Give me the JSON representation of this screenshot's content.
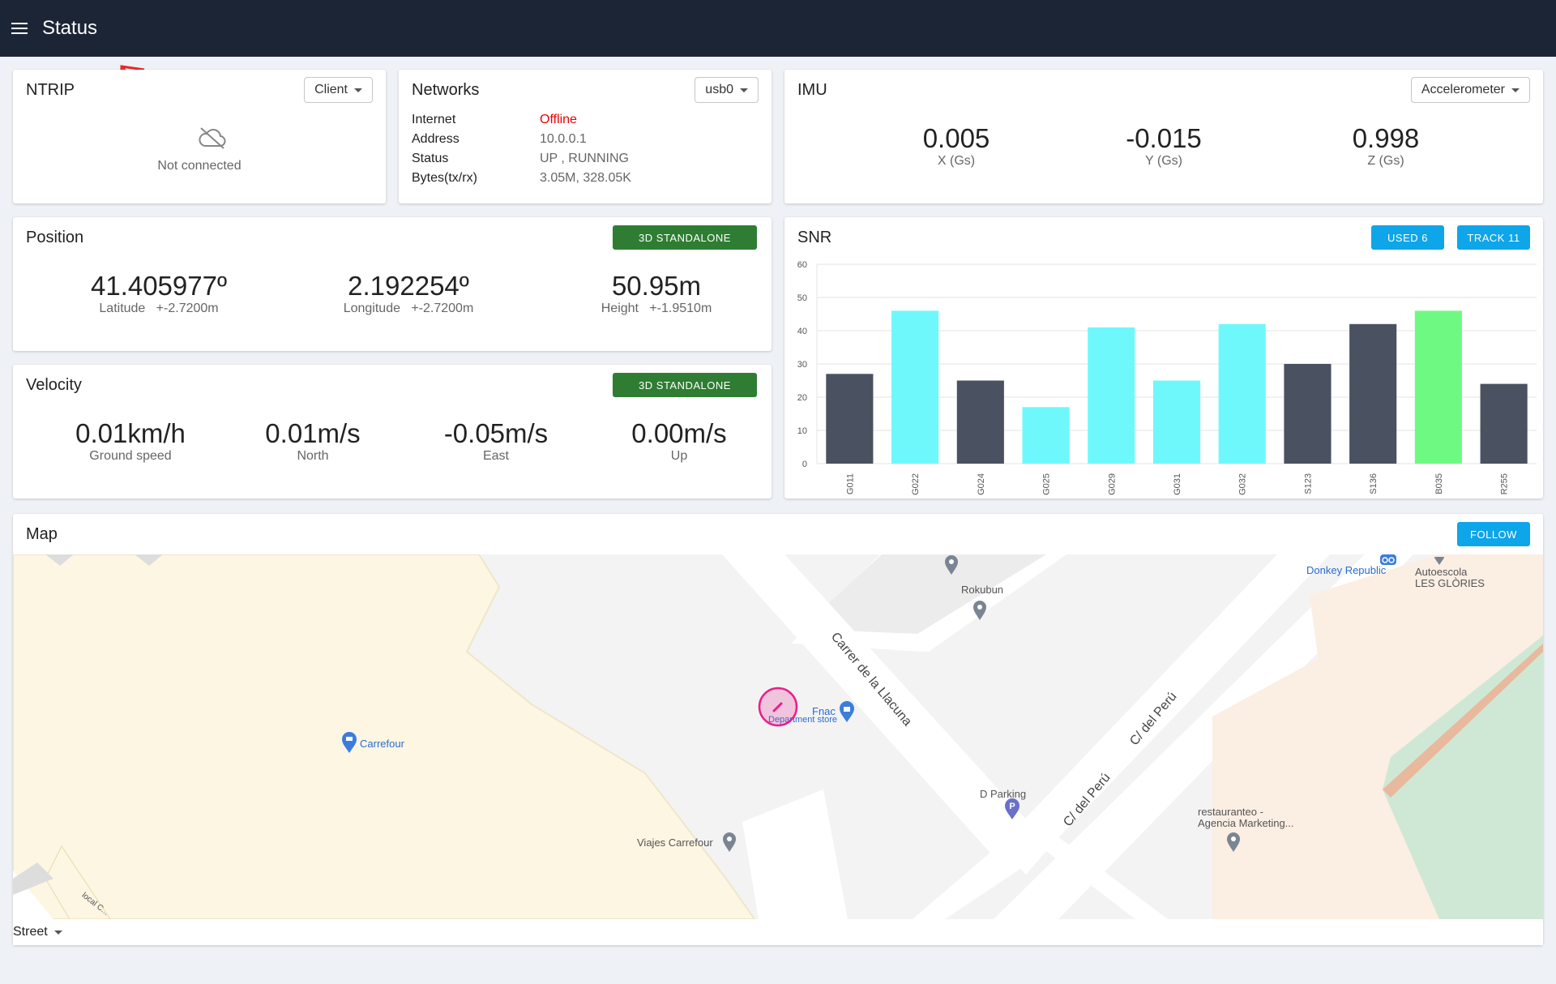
{
  "header": {
    "title": "Status",
    "menu_icon": "menu-icon"
  },
  "ntrip": {
    "title": "NTRIP",
    "mode": "Client",
    "status_icon": "cloud-off-icon",
    "status": "Not connected"
  },
  "networks": {
    "title": "Networks",
    "interface": "usb0",
    "rows": [
      {
        "key": "Internet",
        "value": "Offline"
      },
      {
        "key": "Address",
        "value": "10.0.0.1"
      },
      {
        "key": "Status",
        "value": "UP , RUNNING"
      },
      {
        "key": "Bytes(tx/rx)",
        "value": "3.05M, 328.05K"
      }
    ]
  },
  "imu": {
    "title": "IMU",
    "sensor": "Accelerometer",
    "x": {
      "value": "0.005",
      "label": "X (Gs)"
    },
    "y": {
      "value": "-0.015",
      "label": "Y (Gs)"
    },
    "z": {
      "value": "0.998",
      "label": "Z (Gs)"
    }
  },
  "position": {
    "title": "Position",
    "fix": "3D STANDALONE",
    "latitude": {
      "value": "41.405977º",
      "label": "Latitude",
      "accuracy": "+-2.7200m"
    },
    "longitude": {
      "value": "2.192254º",
      "label": "Longitude",
      "accuracy": "+-2.7200m"
    },
    "height": {
      "value": "50.95m",
      "label": "Height",
      "accuracy": "+-1.9510m"
    }
  },
  "velocity": {
    "title": "Velocity",
    "fix": "3D STANDALONE",
    "ground": {
      "value": "0.01km/h",
      "label": "Ground speed"
    },
    "north": {
      "value": "0.01m/s",
      "label": "North"
    },
    "east": {
      "value": "-0.05m/s",
      "label": "East"
    },
    "up": {
      "value": "0.00m/s",
      "label": "Up"
    }
  },
  "snr": {
    "title": "SNR",
    "used_label": "USED 6",
    "track_label": "TRACK 11"
  },
  "chart_data": {
    "type": "bar",
    "title": "SNR",
    "categories": [
      "G011",
      "G022",
      "G024",
      "G025",
      "G029",
      "G031",
      "G032",
      "S123",
      "S136",
      "B035",
      "R255"
    ],
    "values": [
      27,
      46,
      25,
      17,
      41,
      25,
      42,
      30,
      42,
      46,
      24
    ],
    "colors": [
      "#4a5160",
      "#6ff8fc",
      "#4a5160",
      "#6ff8fc",
      "#6ff8fc",
      "#6ff8fc",
      "#6ff8fc",
      "#4a5160",
      "#4a5160",
      "#6efa82",
      "#4a5160"
    ],
    "ylim": [
      0,
      60
    ],
    "yticks": [
      0,
      10,
      20,
      30,
      40,
      50,
      60
    ],
    "grid": true
  },
  "map": {
    "title": "Map",
    "follow_label": "FOLLOW",
    "layer": "Street",
    "labels": {
      "rokubun": "Rokubun",
      "donkey": "Donkey Republic",
      "autoescola1": "Autoescola",
      "autoescola2": "LES GLÒRIES",
      "carrer": "Carrer de la Llacuna",
      "peru1": "C/ del Perú",
      "peru2": "C/ del Perú",
      "fnac": "Fnac",
      "fnac_sub": "Department store",
      "carrefour": "Carrefour",
      "dparking": "D Parking",
      "restaurant1": "restauranteo -",
      "restaurant2": "Agencia Marketing...",
      "viajes": "Viajes Carrefour",
      "local": "local C..."
    },
    "colors": {
      "building": "#fdf6e3",
      "road": "#ffffff",
      "park": "#cfe8d5",
      "position": "#e91e8c"
    }
  }
}
